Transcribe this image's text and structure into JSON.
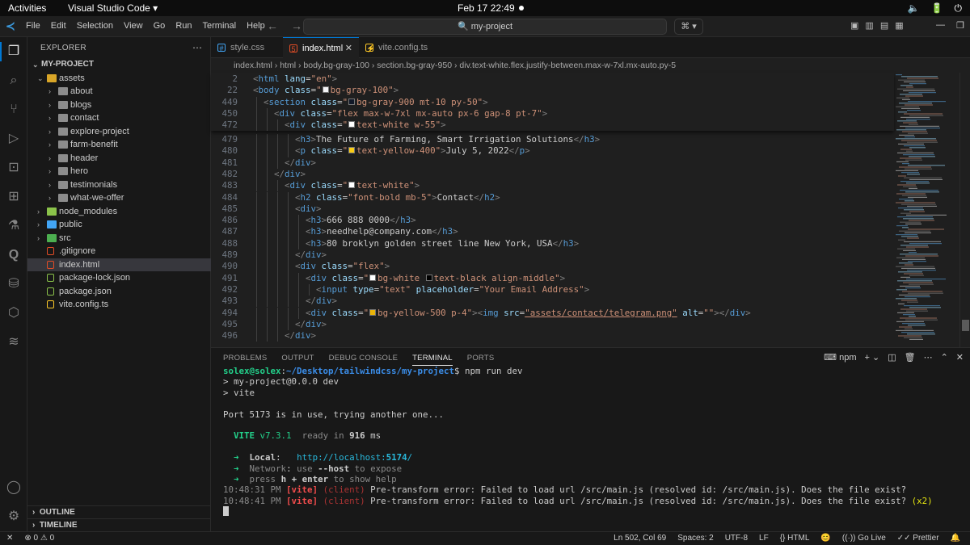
{
  "gnome": {
    "activities": "Activities",
    "app": "Visual Studio Code ▾",
    "clock": "Feb 17  22:49",
    "tray": [
      "🔈",
      "🔋",
      "⏻"
    ]
  },
  "titlebar": {
    "menu": [
      "File",
      "Edit",
      "Selection",
      "View",
      "Go",
      "Run",
      "Terminal",
      "Help"
    ],
    "search": "🔍 my-project"
  },
  "explorer": {
    "title": "EXPLORER",
    "root": "MY-PROJECT",
    "items": [
      {
        "name": "assets",
        "kind": "folder-open",
        "depth": 1
      },
      {
        "name": "about",
        "kind": "folder",
        "depth": 2
      },
      {
        "name": "blogs",
        "kind": "folder",
        "depth": 2
      },
      {
        "name": "contact",
        "kind": "folder",
        "depth": 2
      },
      {
        "name": "explore-project",
        "kind": "folder",
        "depth": 2
      },
      {
        "name": "farm-benefit",
        "kind": "folder",
        "depth": 2
      },
      {
        "name": "header",
        "kind": "folder",
        "depth": 2
      },
      {
        "name": "hero",
        "kind": "folder",
        "depth": 2
      },
      {
        "name": "testimonials",
        "kind": "folder",
        "depth": 2
      },
      {
        "name": "what-we-offer",
        "kind": "folder",
        "depth": 2
      },
      {
        "name": "node_modules",
        "kind": "folder",
        "depth": 1
      },
      {
        "name": "public",
        "kind": "folder",
        "depth": 1
      },
      {
        "name": "src",
        "kind": "folder",
        "depth": 1
      },
      {
        "name": ".gitignore",
        "kind": "file",
        "depth": 1
      },
      {
        "name": "index.html",
        "kind": "file",
        "depth": 1
      },
      {
        "name": "package-lock.json",
        "kind": "file",
        "depth": 1
      },
      {
        "name": "package.json",
        "kind": "file",
        "depth": 1
      },
      {
        "name": "vite.config.ts",
        "kind": "file",
        "depth": 1
      }
    ],
    "outline": "OUTLINE",
    "timeline": "TIMELINE"
  },
  "tabs": [
    {
      "label": "style.css",
      "active": false,
      "color": "#42a5f5",
      "glyph": "#"
    },
    {
      "label": "index.html",
      "active": true,
      "color": "#e44d26",
      "glyph": "5"
    },
    {
      "label": "vite.config.ts",
      "active": false,
      "color": "#ffca28",
      "glyph": "⚡"
    }
  ],
  "breadcrumbs": [
    "index.html",
    "html",
    "body.bg-gray-100",
    "section.bg-gray-950",
    "div.text-white.flex.justify-between.max-w-7xl.mx-auto.py-5"
  ],
  "code": {
    "sticky": [
      {
        "n": "2",
        "html": "<span class='p'>&lt;</span><span class='t'>html</span> <span class='a'>lang</span>=<span class='s'>\"en\"</span><span class='p'>&gt;</span>",
        "indent": 0
      },
      {
        "n": "22",
        "html": "<span class='p'>&lt;</span><span class='t'>body</span> <span class='a'>class</span>=<span class='s'>\"<i class='sw' style='background:#f3f4f6'></i>bg-gray-100\"</span><span class='p'>&gt;</span>",
        "indent": 0
      },
      {
        "n": "449",
        "html": "<span class='p'>&lt;</span><span class='t'>section</span> <span class='a'>class</span>=<span class='s'>\"<i class='sw' style='background:#111827'></i>bg-gray-900 mt-10 py-50\"</span><span class='p'>&gt;</span>",
        "indent": 1
      },
      {
        "n": "450",
        "html": "<span class='p'>&lt;</span><span class='t'>div</span> <span class='a'>class</span>=<span class='s'>\"flex max-w-7xl mx-auto px-6 gap-8 pt-7\"</span><span class='p'>&gt;</span>",
        "indent": 2
      },
      {
        "n": "472",
        "html": "<span class='p'>&lt;</span><span class='t'>div</span> <span class='a'>class</span>=<span class='s'>\"<i class='sw' style='background:#ffffff'></i>text-white w-55\"</span><span class='p'>&gt;</span>",
        "indent": 3
      }
    ],
    "lines": [
      {
        "n": "479",
        "html": "<span class='p'>&lt;</span><span class='t'>h3</span><span class='p'>&gt;</span>The Future of Farming, Smart Irrigation Solutions<span class='p'>&lt;/</span><span class='t'>h3</span><span class='p'>&gt;</span>",
        "indent": 4
      },
      {
        "n": "480",
        "html": "<span class='p'>&lt;</span><span class='t'>p</span> <span class='a'>class</span>=<span class='s'>\"<i class='sw' style='background:#facc15'></i>text-yellow-400\"</span><span class='p'>&gt;</span>July 5, 2022<span class='p'>&lt;/</span><span class='t'>p</span><span class='p'>&gt;</span>",
        "indent": 4
      },
      {
        "n": "481",
        "html": "<span class='p'>&lt;/</span><span class='t'>div</span><span class='p'>&gt;</span>",
        "indent": 3
      },
      {
        "n": "482",
        "html": "<span class='p'>&lt;/</span><span class='t'>div</span><span class='p'>&gt;</span>",
        "indent": 2
      },
      {
        "n": "483",
        "html": "<span class='p'>&lt;</span><span class='t'>div</span> <span class='a'>class</span>=<span class='s'>\"<i class='sw' style='background:#ffffff'></i>text-white\"</span><span class='p'>&gt;</span>",
        "indent": 3
      },
      {
        "n": "484",
        "html": "<span class='p'>&lt;</span><span class='t'>h2</span> <span class='a'>class</span>=<span class='s'>\"font-bold mb-5\"</span><span class='p'>&gt;</span>Contact<span class='p'>&lt;/</span><span class='t'>h2</span><span class='p'>&gt;</span>",
        "indent": 4
      },
      {
        "n": "485",
        "html": "<span class='p'>&lt;</span><span class='t'>div</span><span class='p'>&gt;</span>",
        "indent": 4
      },
      {
        "n": "486",
        "html": "<span class='p'>&lt;</span><span class='t'>h3</span><span class='p'>&gt;</span>666 888 0000<span class='p'>&lt;/</span><span class='t'>h3</span><span class='p'>&gt;</span>",
        "indent": 5
      },
      {
        "n": "487",
        "html": "<span class='p'>&lt;</span><span class='t'>h3</span><span class='p'>&gt;</span>needhelp@company.com<span class='p'>&lt;/</span><span class='t'>h3</span><span class='p'>&gt;</span>",
        "indent": 5
      },
      {
        "n": "488",
        "html": "<span class='p'>&lt;</span><span class='t'>h3</span><span class='p'>&gt;</span>80 broklyn golden street line New York, USA<span class='p'>&lt;/</span><span class='t'>h3</span><span class='p'>&gt;</span>",
        "indent": 5
      },
      {
        "n": "489",
        "html": "<span class='p'>&lt;/</span><span class='t'>div</span><span class='p'>&gt;</span>",
        "indent": 4
      },
      {
        "n": "490",
        "html": "<span class='p'>&lt;</span><span class='t'>div</span> <span class='a'>class</span>=<span class='s'>\"flex\"</span><span class='p'>&gt;</span>",
        "indent": 4
      },
      {
        "n": "491",
        "html": "<span class='p'>&lt;</span><span class='t'>div</span> <span class='a'>class</span>=<span class='s'>\"<i class='sw' style='background:#ffffff'></i>bg-white <i class='sw' style='background:#000000'></i>text-black align-middle\"</span><span class='p'>&gt;</span>",
        "indent": 5
      },
      {
        "n": "492",
        "html": "<span class='p'>&lt;</span><span class='t'>input</span> <span class='a'>type</span>=<span class='s'>\"text\"</span> <span class='a'>placeholder</span>=<span class='s'>\"Your Email Address\"</span><span class='p'>&gt;</span>",
        "indent": 6
      },
      {
        "n": "493",
        "html": "<span class='p'>&lt;/</span><span class='t'>div</span><span class='p'>&gt;</span>",
        "indent": 5
      },
      {
        "n": "494",
        "html": "<span class='p'>&lt;</span><span class='t'>div</span> <span class='a'>class</span>=<span class='s'>\"<i class='sw' style='background:#eab308'></i>bg-yellow-500 p-4\"</span><span class='p'>&gt;&lt;</span><span class='t'>img</span> <span class='a'>src</span>=<span class='u'>\"assets/contact/telegram.png\"</span> <span class='a'>alt</span>=<span class='s'>\"\"</span><span class='p'>&gt;&lt;/</span><span class='t'>div</span><span class='p'>&gt;</span>",
        "indent": 5
      },
      {
        "n": "495",
        "html": "<span class='p'>&lt;/</span><span class='t'>div</span><span class='p'>&gt;</span>",
        "indent": 4
      },
      {
        "n": "496",
        "html": "<span class='p'>&lt;/</span><span class='t'>div</span><span class='p'>&gt;</span>",
        "indent": 3
      }
    ]
  },
  "panel": {
    "tabs": [
      "PROBLEMS",
      "OUTPUT",
      "DEBUG CONSOLE",
      "TERMINAL",
      "PORTS"
    ],
    "active": "TERMINAL",
    "shell": "npm"
  },
  "terminal": [
    "<span class='g'>solex@solex</span>:<span class='b'>~/Desktop/tailwindcss/my-project</span>$ npm run dev",
    "&gt; my-project@0.0.0 dev",
    "&gt; vite",
    "",
    "Port 5173 is in use, trying another one...",
    "",
    "  <span class='g'>VITE</span> <span class='g' style='font-weight:normal'>v7.3.1</span>  <span class='dim'>ready in</span> <b>916</b> ms",
    "",
    "  <span class='g'>➜</span>  <b>Local</b>:   <span class='cy'>http://localhost:<b>5174</b>/</span>",
    "  <span class='g' style='font-weight:normal'>➜</span>  <span class='dim'>Network</span>: <span class='dim'>use</span> <b>--host</b> <span class='dim'>to expose</span>",
    "  <span class='g' style='font-weight:normal'>➜</span>  <span class='dim'>press</span> <b>h + enter</b> <span class='dim'>to show help</span>",
    "<span class='dim'>10:48:31 PM</span> <span class='red'>[vite]</span> <span class='dred'>(client)</span> Pre-transform error: Failed to load url /src/main.js (resolved id: /src/main.js). Does the file exist?",
    "<span class='dim'>10:48:41 PM</span> <span class='red'>[vite]</span> <span class='dred'>(client)</span> Pre-transform error: Failed to load url /src/main.js (resolved id: /src/main.js). Does the file exist? <span class='yel'>(x2)</span>"
  ],
  "statusbar": {
    "left": [
      "✕",
      "⊗ 0 ⚠ 0"
    ],
    "right": [
      "Ln 502, Col 69",
      "Spaces: 2",
      "UTF-8",
      "LF",
      "{} HTML",
      "😊",
      "((·)) Go Live",
      "✓✓ Prettier",
      "🔔"
    ]
  }
}
